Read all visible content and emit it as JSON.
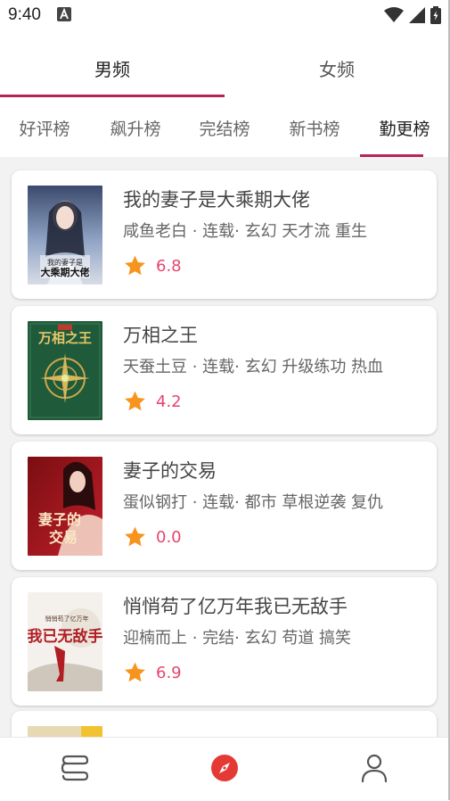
{
  "status_bar": {
    "time": "9:40"
  },
  "gender_tabs": [
    {
      "label": "男频",
      "active": true
    },
    {
      "label": "女频",
      "active": false
    }
  ],
  "rank_tabs": [
    {
      "label": "好评榜"
    },
    {
      "label": "飙升榜"
    },
    {
      "label": "完结榜"
    },
    {
      "label": "新书榜"
    },
    {
      "label": "勤更榜"
    }
  ],
  "active_rank_tab": "勤更榜",
  "books": [
    {
      "title": "我的妻子是大乘期大佬",
      "meta": "咸鱼老白 · 连载· 玄幻 天才流 重生",
      "rating": "6.8",
      "cover_text": "我的妻子是大乘期大佬"
    },
    {
      "title": "万相之王",
      "meta": "天蚕土豆 · 连载· 玄幻 升级练功 热血",
      "rating": "4.2",
      "cover_text": "万相之王"
    },
    {
      "title": "妻子的交易",
      "meta": "蛋似钢打 · 连载· 都市 草根逆袭 复仇",
      "rating": "0.0",
      "cover_text": "妻子的交易"
    },
    {
      "title": "悄悄苟了亿万年我已无敌手",
      "meta": "迎楠而上 · 完结· 玄幻 苟道 搞笑",
      "rating": "6.9",
      "cover_text": "我已无敌手"
    }
  ],
  "colors": {
    "accent": "#b5245a",
    "rating": "#e5466e",
    "star": "#f7941d",
    "nav_active": "#e53935"
  },
  "bottom_nav": [
    {
      "icon": "bookshelf-icon"
    },
    {
      "icon": "compass-icon",
      "active": true
    },
    {
      "icon": "profile-icon"
    }
  ]
}
